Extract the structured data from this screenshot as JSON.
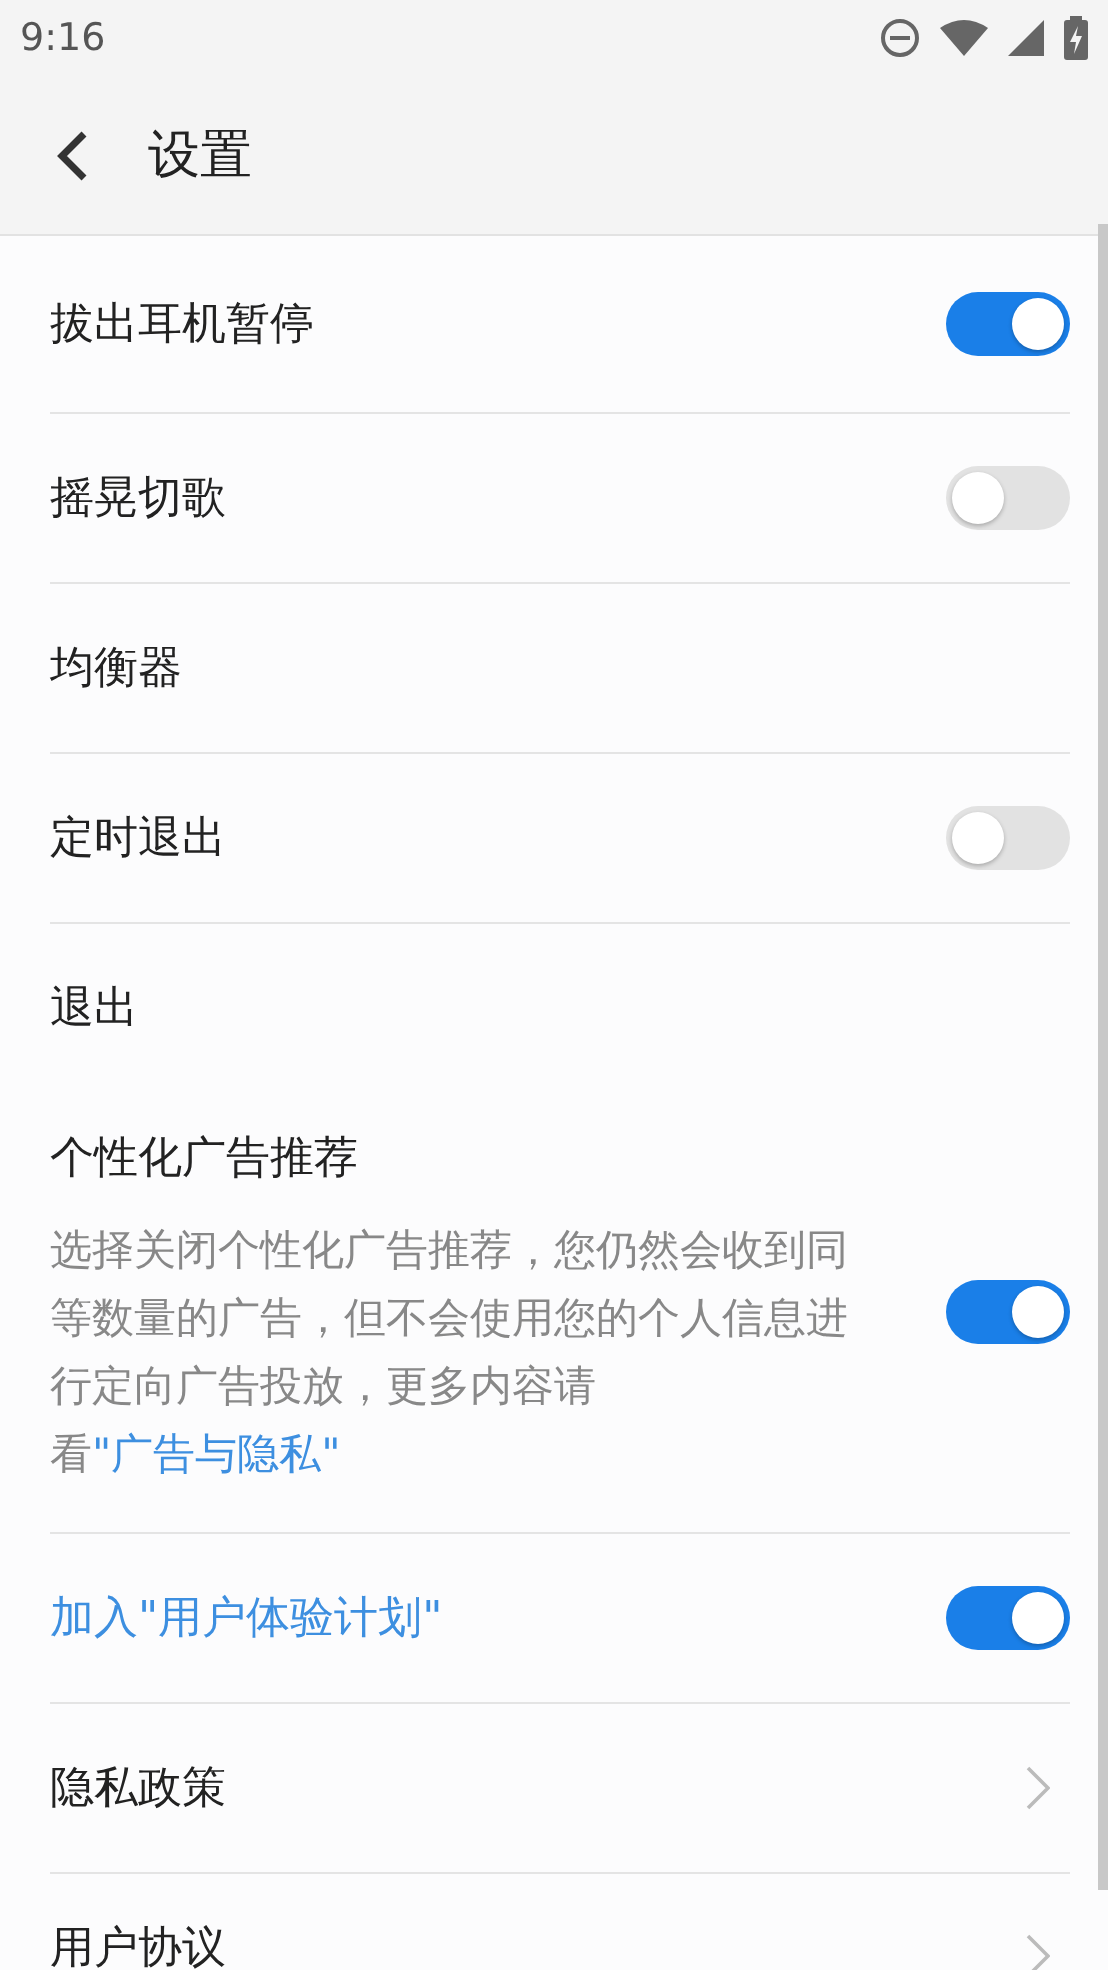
{
  "status_bar": {
    "time": "9:16"
  },
  "header": {
    "title": "设置"
  },
  "items": [
    {
      "kind": "toggle",
      "label": "拔出耳机暂停",
      "on": true
    },
    {
      "kind": "toggle",
      "label": "摇晃切歌",
      "on": false
    },
    {
      "kind": "plain",
      "label": "均衡器"
    },
    {
      "kind": "toggle",
      "label": "定时退出",
      "on": false
    },
    {
      "kind": "plain",
      "label": "退出"
    },
    {
      "kind": "description-toggle",
      "label": "个性化广告推荐",
      "description": "选择关闭个性化广告推荐，您仍然会收到同等数量的广告，但不会使用您的个人信息进行定向广告投放，更多内容请看",
      "link": "\"广告与隐私\"",
      "on": true
    },
    {
      "kind": "accent-toggle",
      "label": "加入\"用户体验计划\"",
      "on": true
    },
    {
      "kind": "chevron",
      "label": "隐私政策"
    },
    {
      "kind": "chevron",
      "label": "用户协议"
    }
  ]
}
